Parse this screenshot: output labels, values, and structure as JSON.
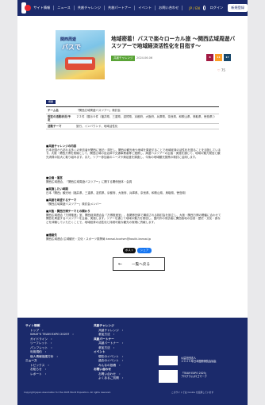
{
  "header": {
    "nav": [
      "サイト情報",
      "ニュース",
      "共創チャレンジ",
      "共創パートナー",
      "イベント",
      "お問い合わせ"
    ],
    "lang": "JP / EN",
    "login": "ログイン",
    "signup": "新規登録"
  },
  "project": {
    "hero_text_1": "関西周遊",
    "hero_text_2": "バスで",
    "title": "地域密着！バスで楽々ローカル旅 〜関西広域周遊バスツアーで地域経済活性化を目指す〜",
    "category": "共創チャレンジ",
    "date": "2024.06.06",
    "sdg_numbers": [
      "8",
      "11",
      "17"
    ],
    "likes": "75"
  },
  "info": {
    "tag": "概要",
    "rows": [
      {
        "key": "チーム名",
        "value": "「関西広域周遊バスツアー」検討会"
      },
      {
        "key": "現在の活動状況/予定",
        "value": "２２件（展示６件（福井県、三重県、滋賀県、京都府、大阪府、兵庫県、奈良県、和歌山県、鳥取県、徳島県））"
      },
      {
        "key": "活動テーマ",
        "value": "旅行、インバウンド、地域活性化"
      }
    ]
  },
  "desc": {
    "h1": "■共創チャレンジの内容",
    "p1": "日本全国から訪れる多くの来訪者が関西に宿泊・滞在し、関西の観光地や地域を周遊することで地域経済の活性化を図ることを目指しています。大阪・関西万博を契機として、関西広域の自治体や交通事業者等と連携し、周遊バスツアーの企画・実施を通じて、地域の魅力発信と観光消費の拡大に取り組みます。また、ツアー参加者のニーズや満足度を調査し、今後の地域観光施策の検討に活用します。",
    "h2": "■企画・運営",
    "p2": "関西広域連合、「関西広域周遊バスツアー」に関する関係団体・会員",
    "h3": "■実施したい時期",
    "p3": "日本「関西」観光地（福井県、三重県、滋賀県、京都府、大阪府、兵庫県、奈良県、和歌山県、鳥取県、徳島県）",
    "h4": "■共創を希望するテーマ",
    "p4": "「関西広域周遊バスツアー」検討会メンバー",
    "h5": "■大阪・関西万博テーマとの関わり",
    "p5": "関西広域連合「万博推進」室、関西経済連合会「万博推進室」、各関係団体で構成される検討会を設立し、大阪・関西万博の開催に合わせて関西を周遊するバスツアーを企画、実施します。ツアーを通じて地域の魅力を発信し、国内外の来訪者に関西各地の自然・歴史・文化・食などを体験していただくことで、地域経済の活性化と持続可能な観光の実現に貢献します。",
    "h6": "■連絡先",
    "p6": "関西広域連合 広域観光・文化・スポーツ振興局  kansai-tourism@kouiki-kansai.jp"
  },
  "share": {
    "x": "ポスト",
    "fb": "シェア"
  },
  "back": {
    "label": "一覧へ戻る"
  },
  "footer": {
    "col1": {
      "heading": "サイト情報",
      "items": [
        "トップ",
        "WHAT'S TEAM EXPO 2025?",
        "ガイドライン",
        "リーフレット",
        "パンフレット",
        "利用規約",
        "個人情報保護方針"
      ]
    },
    "col1b": {
      "heading": "ニュース",
      "items": [
        "トピックス",
        "お知らせ",
        "レポート"
      ]
    },
    "col2": {
      "heading": "共創チャレンジ",
      "items": [
        "共創チャレンジ",
        "参加方法"
      ],
      "heading2": "共創パートナー",
      "items2": [
        "共創パートナー",
        "参加方法"
      ],
      "heading3": "イベント",
      "items3": [
        "現在のイベント",
        "過去のイベント",
        "みんなの投稿"
      ],
      "heading4": "お問い合わせ",
      "items4": [
        "お問い合わせ",
        "よくあるご質問"
      ]
    },
    "org1": "公益社団法人",
    "org2": "２０２５年日本国際博覧会協会",
    "org3": "「TEAM EXPO 2025」",
    "org4": "プログラム/ロゴマーク",
    "copyright": "Copyright Japan Association for the 2025 World Exposition. All rights reserved.",
    "note": "このサイトでは Cookie を使用しています"
  },
  "colors": {
    "navy": "#1b2a6b",
    "green": "#5aa437",
    "sdg8": "#a21942",
    "sdg11": "#fd9d24",
    "sdg17": "#19486a"
  }
}
